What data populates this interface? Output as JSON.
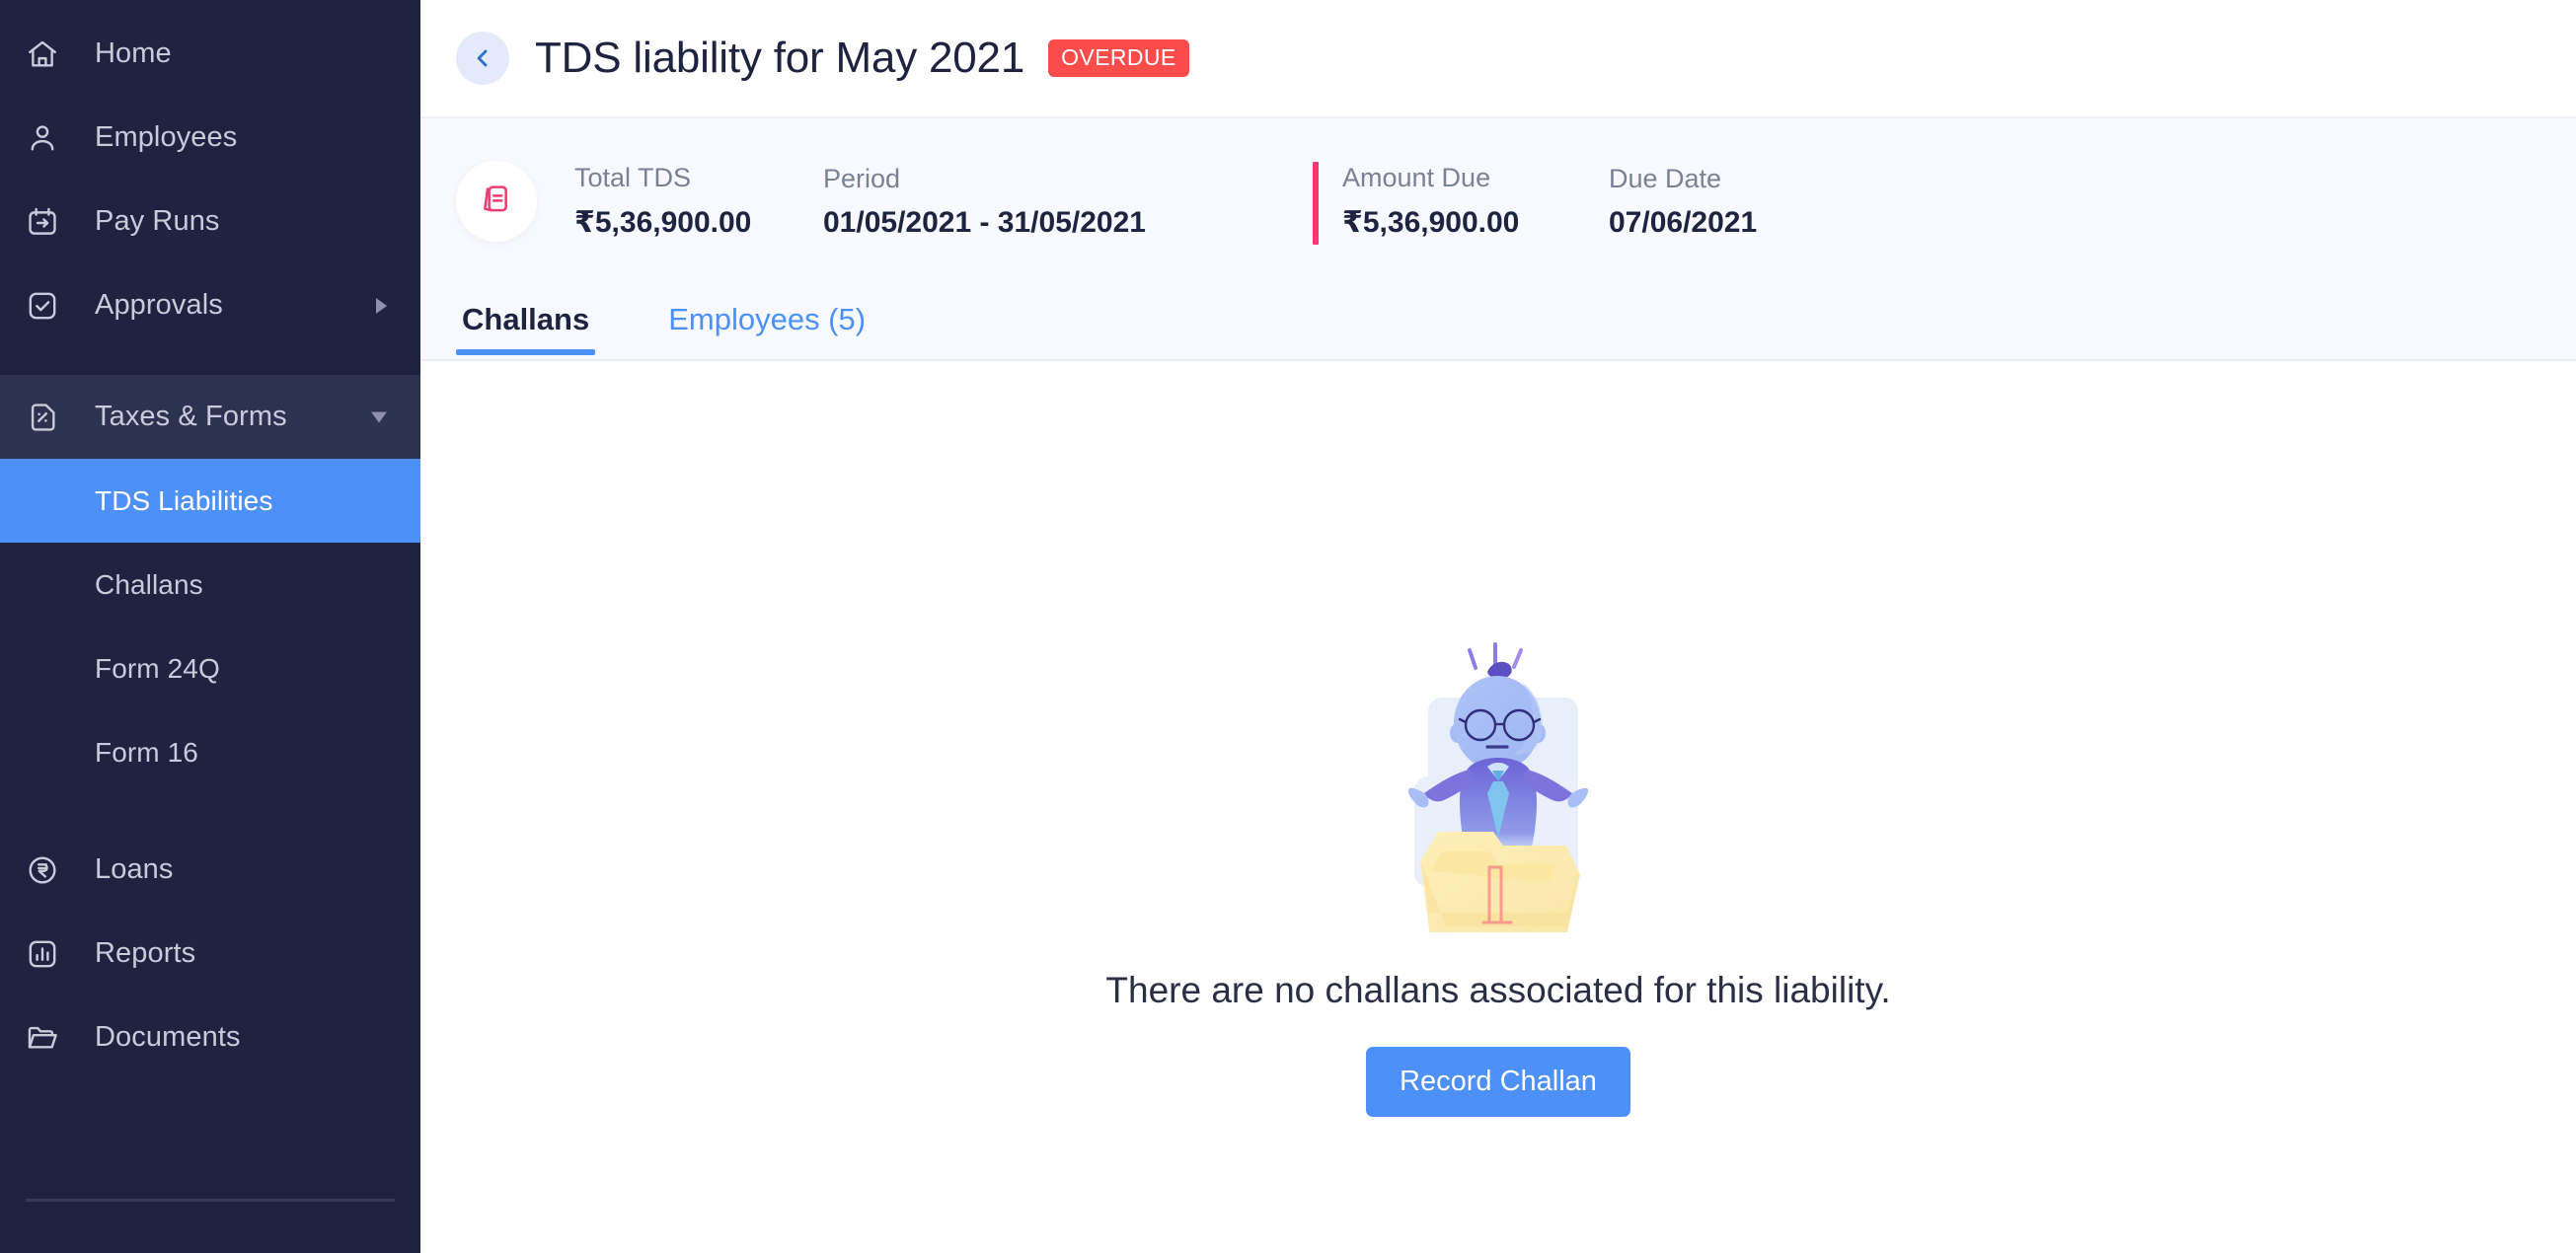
{
  "sidebar": {
    "items": [
      {
        "label": "Home",
        "icon": "home-icon",
        "type": "top"
      },
      {
        "label": "Employees",
        "icon": "user-icon",
        "type": "top"
      },
      {
        "label": "Pay Runs",
        "icon": "calendar-arrow-icon",
        "type": "top"
      },
      {
        "label": "Approvals",
        "icon": "check-square-icon",
        "type": "top",
        "caret": "right"
      },
      {
        "label": "Taxes & Forms",
        "icon": "percent-doc-icon",
        "type": "group",
        "caret": "down"
      },
      {
        "label": "TDS Liabilities",
        "type": "sub",
        "active": true
      },
      {
        "label": "Challans",
        "type": "sub"
      },
      {
        "label": "Form 24Q",
        "type": "sub"
      },
      {
        "label": "Form 16",
        "type": "sub"
      },
      {
        "label": "Loans",
        "icon": "rupee-circle-icon",
        "type": "top"
      },
      {
        "label": "Reports",
        "icon": "bar-chart-icon",
        "type": "top"
      },
      {
        "label": "Documents",
        "icon": "folder-open-icon",
        "type": "top"
      }
    ]
  },
  "header": {
    "back_label": "Back",
    "title": "TDS liability for May 2021",
    "badge": "OVERDUE",
    "badge_color": "#FB4C4C"
  },
  "summary": {
    "icon": "documents-stack-icon",
    "total_tds": {
      "label": "Total TDS",
      "value": "₹5,36,900.00"
    },
    "period": {
      "label": "Period",
      "value": "01/05/2021 - 31/05/2021"
    },
    "amount_due": {
      "label": "Amount Due",
      "value": "₹5,36,900.00",
      "accent_color": "#EE3A6E"
    },
    "due_date": {
      "label": "Due Date",
      "value": "07/06/2021"
    }
  },
  "tabs": [
    {
      "label": "Challans",
      "active": true
    },
    {
      "label": "Employees (5)",
      "active": false
    }
  ],
  "empty_state": {
    "illustration": "genie-in-folder-illustration",
    "message": "There are no challans associated for this liability.",
    "button_label": "Record Challan",
    "button_color": "#4D90F8"
  }
}
